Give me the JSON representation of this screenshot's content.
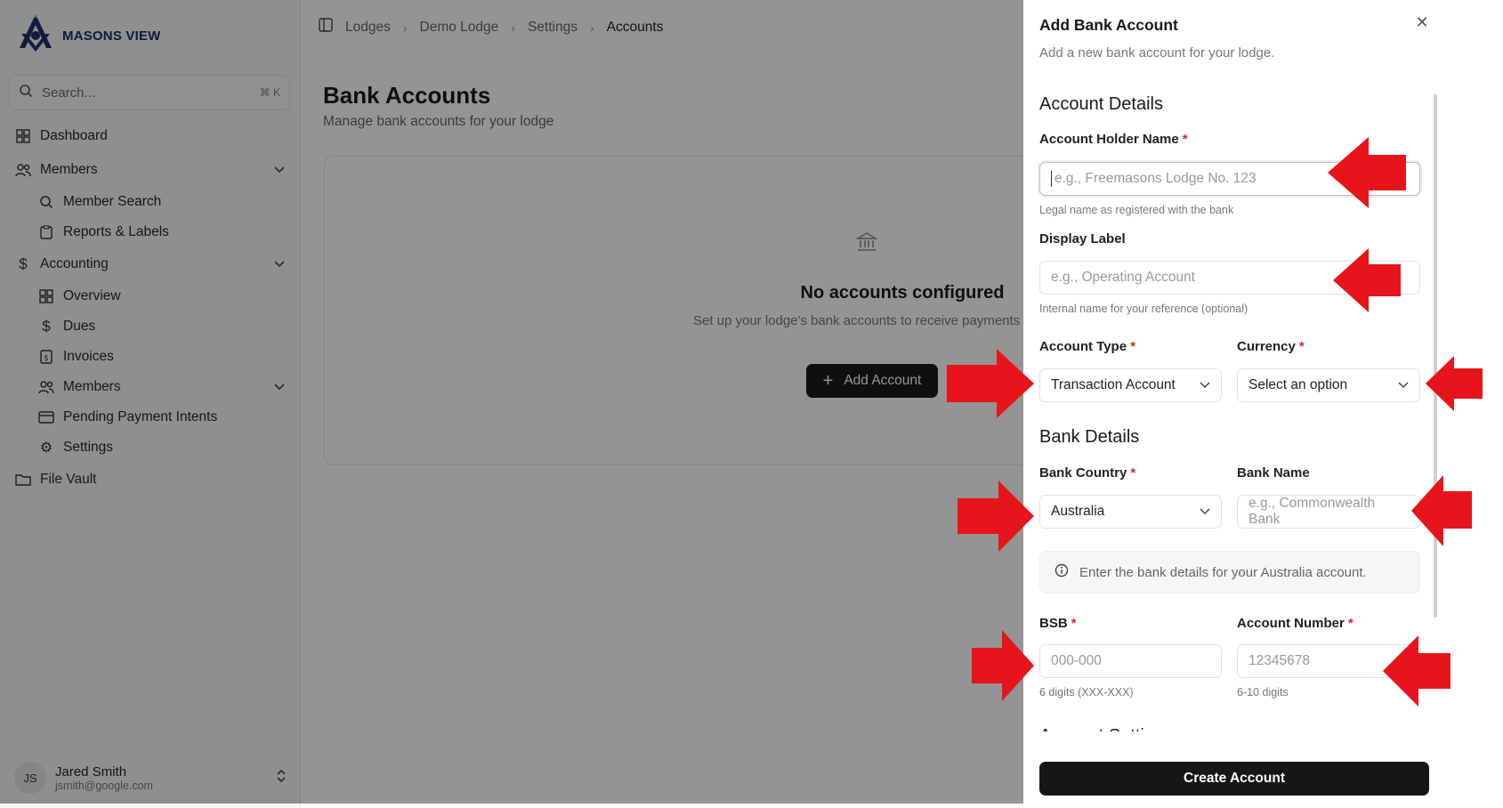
{
  "app": {
    "name": "MASONS VIEW"
  },
  "search": {
    "placeholder": "Search...",
    "shortcut": "⌘ K"
  },
  "sidebar": {
    "items": [
      {
        "label": "Dashboard",
        "icon": "grid-icon"
      },
      {
        "label": "Members",
        "icon": "users-icon"
      },
      {
        "label": "Member Search",
        "icon": "search-icon"
      },
      {
        "label": "Reports & Labels",
        "icon": "clipboard-icon"
      },
      {
        "label": "Accounting",
        "icon": "dollar-icon"
      },
      {
        "label": "Overview",
        "icon": "grid-icon"
      },
      {
        "label": "Dues",
        "icon": "dollar-icon"
      },
      {
        "label": "Invoices",
        "icon": "receipt-icon"
      },
      {
        "label": "Members",
        "icon": "users-icon"
      },
      {
        "label": "Pending Payment Intents",
        "icon": "credit-card-icon"
      },
      {
        "label": "Settings",
        "icon": "gear-icon"
      },
      {
        "label": "File Vault",
        "icon": "folder-icon"
      }
    ]
  },
  "user": {
    "initials": "JS",
    "name": "Jared Smith",
    "email": "jsmith@google.com"
  },
  "breadcrumb": {
    "items": [
      "Lodges",
      "Demo Lodge",
      "Settings",
      "Accounts"
    ]
  },
  "page": {
    "title": "Bank Accounts",
    "subtitle": "Manage bank accounts for your lodge",
    "empty_title": "No accounts configured",
    "empty_desc": "Set up your lodge's bank accounts to receive payments track finances.",
    "add_button": "Add Account"
  },
  "drawer": {
    "title": "Add Bank Account",
    "description": "Add a new bank account for your lodge.",
    "section_account": "Account Details",
    "holder_label": "Account Holder Name",
    "holder_placeholder": "e.g., Freemasons Lodge No. 123",
    "holder_hint": "Legal name as registered with the bank",
    "display_label": "Display Label",
    "display_placeholder": "e.g., Operating Account",
    "display_hint": "Internal name for your reference (optional)",
    "type_label": "Account Type",
    "type_value": "Transaction Account",
    "currency_label": "Currency",
    "currency_value": "Select an option",
    "section_bank": "Bank Details",
    "country_label": "Bank Country",
    "country_value": "Australia",
    "bankname_label": "Bank Name",
    "bankname_placeholder": "e.g., Commonwealth Bank",
    "info_text": "Enter the bank details for your Australia account.",
    "bsb_label": "BSB",
    "bsb_placeholder": "000-000",
    "bsb_hint": "6 digits (XXX-XXX)",
    "accnum_label": "Account Number",
    "accnum_placeholder": "12345678",
    "accnum_hint": "6-10 digits",
    "next_section_cut": "Account Settings",
    "create_button": "Create Account",
    "required_mark": "*"
  },
  "colors": {
    "accent": "#161616",
    "required": "#e02424",
    "annotation": "#e8141c",
    "brand": "#1e2f6b"
  }
}
